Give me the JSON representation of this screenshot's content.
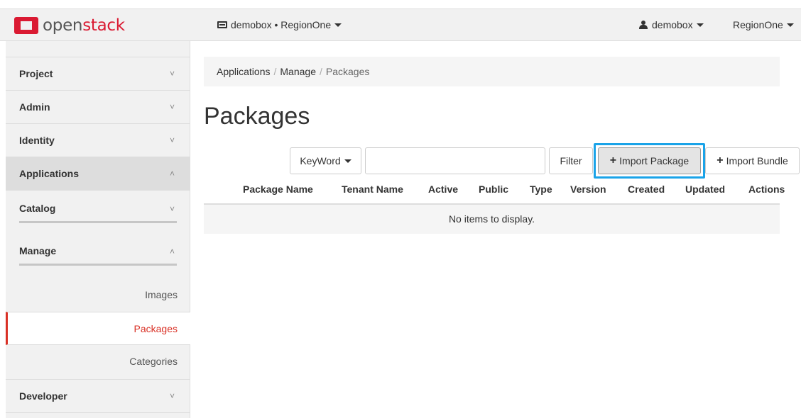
{
  "brand": {
    "prefix": "open",
    "highlight": "stack"
  },
  "header": {
    "project_context": "demobox • RegionOne",
    "user": "demobox",
    "region": "RegionOne"
  },
  "sidebar": {
    "groups": [
      "Project",
      "Admin",
      "Identity",
      "Applications"
    ],
    "catalog": "Catalog",
    "manage": "Manage",
    "leaves": [
      "Images",
      "Packages",
      "Categories"
    ],
    "developer": "Developer",
    "chevron_down": "˅",
    "chevron_up": "˄"
  },
  "breadcrumb": {
    "items": [
      "Applications",
      "Manage"
    ],
    "current": "Packages",
    "separator": "/"
  },
  "page_title": "Packages",
  "toolbar": {
    "keyword_label": "KeyWord",
    "search_value": "",
    "filter_label": "Filter",
    "import_package_label": "Import Package",
    "import_bundle_label": "Import Bundle",
    "plus": "+"
  },
  "table": {
    "columns": [
      "Package Name",
      "Tenant Name",
      "Active",
      "Public",
      "Type",
      "Version",
      "Created",
      "Updated",
      "Actions"
    ],
    "empty_text": "No items to display."
  },
  "colors": {
    "accent": "#da1a32",
    "highlight": "#1aa3e8",
    "active_link": "#d93025"
  }
}
